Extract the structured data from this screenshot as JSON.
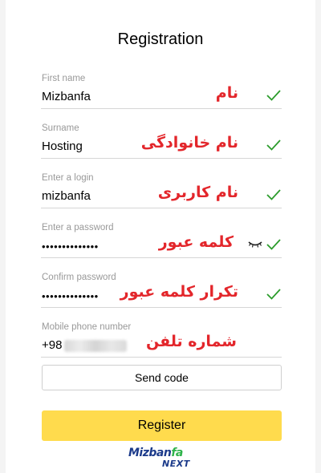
{
  "header": {
    "title": "Registration"
  },
  "fields": [
    {
      "label": "First name",
      "value": "Mizbanfa",
      "annotation": "نام"
    },
    {
      "label": "Surname",
      "value": "Hosting",
      "annotation": "نام خانوادگی"
    },
    {
      "label": "Enter a login",
      "value": "mizbanfa",
      "annotation": "نام کاربری"
    },
    {
      "label": "Enter a password",
      "value": "••••••••••••••",
      "annotation": "کلمه عبور"
    },
    {
      "label": "Confirm password",
      "value": "••••••••••••••",
      "annotation": "تکرار کلمه عبور"
    },
    {
      "label": "Mobile phone number",
      "value": "+98",
      "annotation": "شماره تلفن"
    }
  ],
  "buttons": {
    "send_code": "Send code",
    "register": "Register"
  },
  "logo": {
    "brand_a": "Mizban",
    "brand_b": "fa",
    "brand_sub": "NEXT"
  },
  "colors": {
    "accent_yellow": "#ffdb4d",
    "check_green": "#2c9c2c",
    "annotation_red": "#e3262b"
  },
  "icons": {
    "valid": "check-icon",
    "reveal": "eye-icon"
  }
}
